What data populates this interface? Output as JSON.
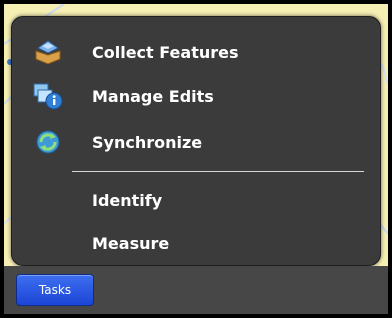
{
  "menu": {
    "items": [
      {
        "label": "Collect Features",
        "icon": "collect-features-icon"
      },
      {
        "label": "Manage Edits",
        "icon": "manage-edits-icon"
      },
      {
        "label": "Synchronize",
        "icon": "synchronize-icon"
      },
      {
        "label": "Identify",
        "icon": ""
      },
      {
        "label": "Measure",
        "icon": ""
      }
    ]
  },
  "bottom_bar": {
    "tasks_label": "Tasks"
  },
  "colors": {
    "menu_background": "#3b3b3b",
    "map_background": "#f6efb4",
    "button_blue": "#2553e0"
  }
}
